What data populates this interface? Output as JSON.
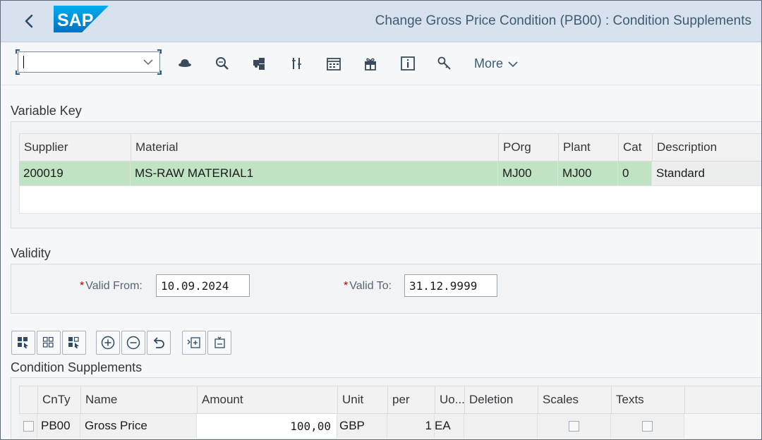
{
  "header": {
    "title": "Change Gross Price Condition (PB00) : Condition Supplements",
    "logo_text": "SAP"
  },
  "toolbar": {
    "command_field_value": "",
    "icons": [
      "display-change-icon",
      "search-icon",
      "puzzle-icon",
      "columns-icon",
      "calendar-icon",
      "gift-icon",
      "info-icon",
      "key-icon"
    ],
    "more_label": "More"
  },
  "variable_key": {
    "title": "Variable Key",
    "columns": [
      "Supplier",
      "Material",
      "POrg",
      "Plant",
      "Cat",
      "Description"
    ],
    "row": [
      "200019",
      "MS-RAW MATERIAL1",
      "MJ00",
      "MJ00",
      "0",
      "Standard"
    ]
  },
  "validity": {
    "title": "Validity",
    "valid_from_label": "Valid From:",
    "valid_from_value": "10.09.2024",
    "valid_to_label": "Valid To:",
    "valid_to_value": "31.12.9999"
  },
  "condition_supplements": {
    "title": "Condition Supplements",
    "columns": [
      "CnTy",
      "Name",
      "Amount",
      "Unit",
      "per",
      "Uo...",
      "Deletion",
      "Scales",
      "Texts"
    ],
    "row": {
      "cnty": "PB00",
      "name": "Gross Price",
      "amount": "100,00",
      "unit": "GBP",
      "per": "1",
      "uom": "EA"
    }
  },
  "colors": {
    "shell": "#d7e2ee",
    "selected_row": "#c0e3c3",
    "accent": "#2d5b8d",
    "required": "#bb0000"
  }
}
